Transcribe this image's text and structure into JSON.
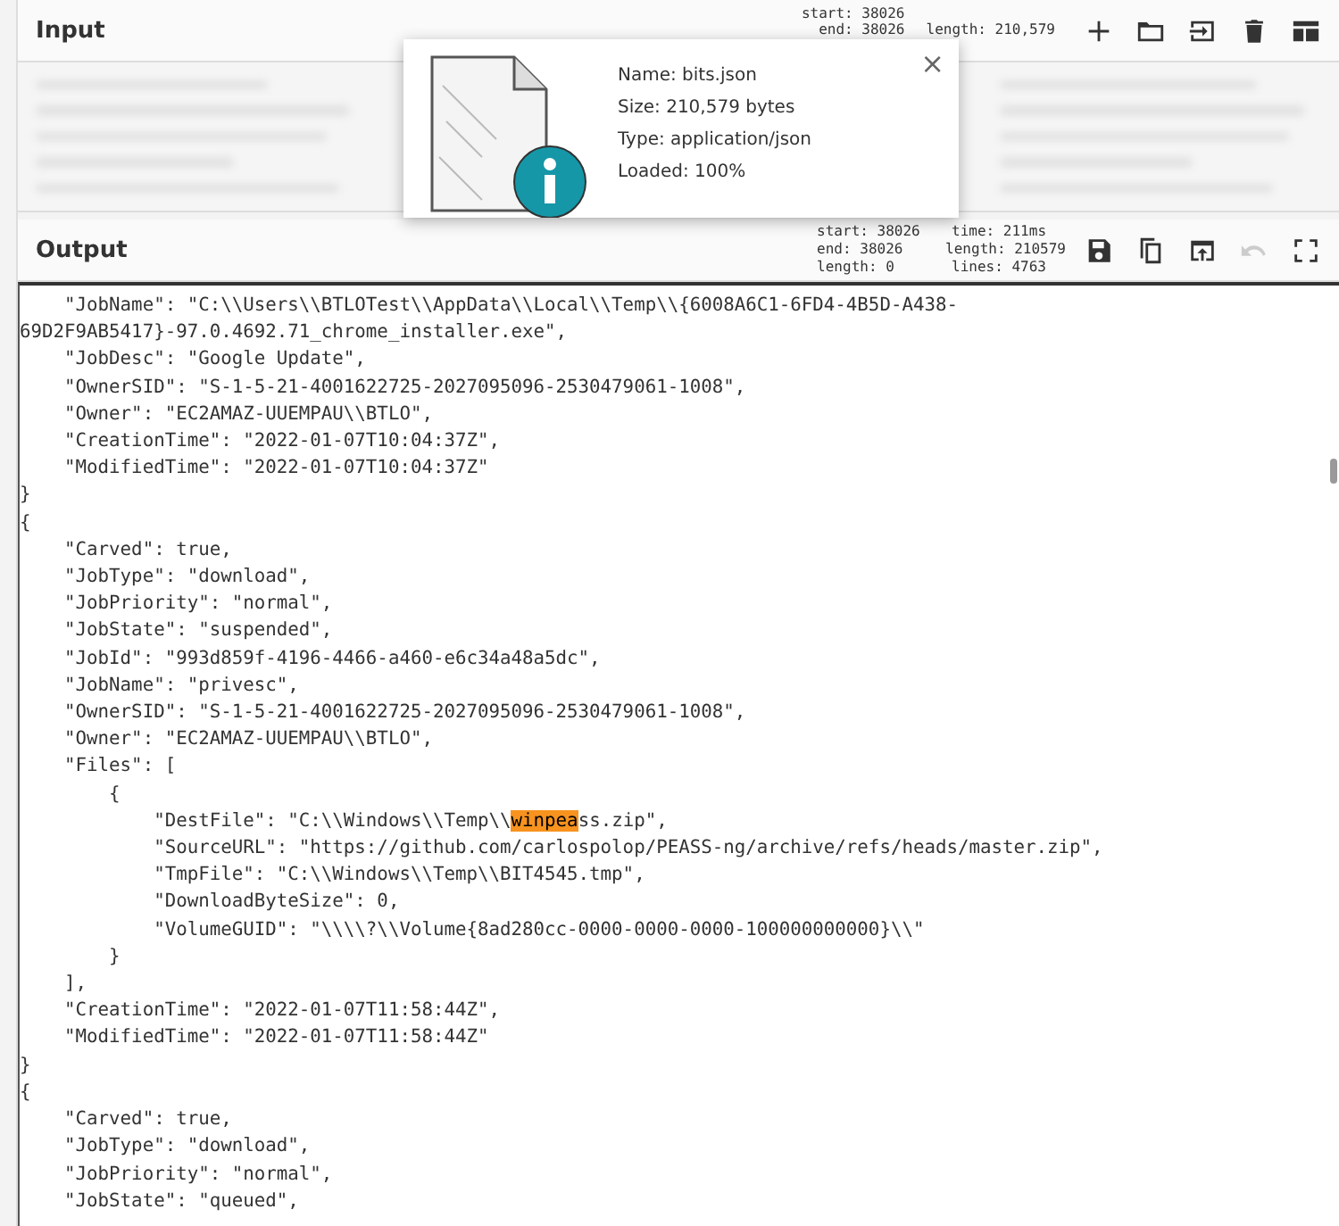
{
  "input": {
    "title": "Input",
    "stats": {
      "start": "start: 38026",
      "end": "end: 38026",
      "length": "length: 210,579"
    }
  },
  "file_popup": {
    "name": "Name: bits.json",
    "size": "Size: 210,579 bytes",
    "type": "Type: application/json",
    "loaded": "Loaded: 100%",
    "close": "×"
  },
  "output": {
    "title": "Output",
    "undo_disabled": true,
    "stats": [
      [
        "start:",
        "38026"
      ],
      [
        "end:",
        "38026"
      ],
      [
        "length:",
        "0"
      ]
    ],
    "stats_2": [
      [
        "time:",
        "211ms"
      ],
      [
        "length:",
        "210579"
      ],
      [
        "lines:",
        "4763"
      ]
    ],
    "lines": [
      {
        "text": "    \"JobName\": \"C:\\\\Users\\\\BTLOTest\\\\AppData\\\\Local\\\\Temp\\\\{6008A6C1-6FD4-4B5D-A438-"
      },
      {
        "text": "69D2F9AB5417}-97.0.4692.71_chrome_installer.exe\","
      },
      {
        "text": "    \"JobDesc\": \"Google Update\","
      },
      {
        "text": "    \"OwnerSID\": \"S-1-5-21-4001622725-2027095096-2530479061-1008\","
      },
      {
        "text": "    \"Owner\": \"EC2AMAZ-UUEMPAU\\\\BTLO\","
      },
      {
        "text": "    \"CreationTime\": \"2022-01-07T10:04:37Z\","
      },
      {
        "text": "    \"ModifiedTime\": \"2022-01-07T10:04:37Z\""
      },
      {
        "text": "}"
      },
      {
        "text": "{"
      },
      {
        "text": "    \"Carved\": true,"
      },
      {
        "text": "    \"JobType\": \"download\","
      },
      {
        "text": "    \"JobPriority\": \"normal\","
      },
      {
        "text": "    \"JobState\": \"suspended\","
      },
      {
        "text": "    \"JobId\": \"993d859f-4196-4466-a460-e6c34a48a5dc\","
      },
      {
        "text": "    \"JobName\": \"privesc\","
      },
      {
        "text": "    \"OwnerSID\": \"S-1-5-21-4001622725-2027095096-2530479061-1008\","
      },
      {
        "text": "    \"Owner\": \"EC2AMAZ-UUEMPAU\\\\BTLO\","
      },
      {
        "text": "    \"Files\": ["
      },
      {
        "text": "        {"
      },
      {
        "text": "            \"DestFile\": \"C:\\\\Windows\\\\Temp\\\\",
        "match": "winpea",
        "after": "ss.zip\","
      },
      {
        "text": "            \"SourceURL\": \"https://github.com/carlospolop/PEASS-ng/archive/refs/heads/master.zip\","
      },
      {
        "text": "            \"TmpFile\": \"C:\\\\Windows\\\\Temp\\\\BIT4545.tmp\","
      },
      {
        "text": "            \"DownloadByteSize\": 0,"
      },
      {
        "text": "            \"VolumeGUID\": \"\\\\\\\\?\\\\Volume{8ad280cc-0000-0000-0000-100000000000}\\\\\""
      },
      {
        "text": "        }"
      },
      {
        "text": "    ],"
      },
      {
        "text": "    \"CreationTime\": \"2022-01-07T11:58:44Z\","
      },
      {
        "text": "    \"ModifiedTime\": \"2022-01-07T11:58:44Z\""
      },
      {
        "text": "}"
      },
      {
        "text": "{"
      },
      {
        "text": "    \"Carved\": true,"
      },
      {
        "text": "    \"JobType\": \"download\","
      },
      {
        "text": "    \"JobPriority\": \"normal\","
      },
      {
        "text": "    \"JobState\": \"queued\","
      }
    ]
  }
}
